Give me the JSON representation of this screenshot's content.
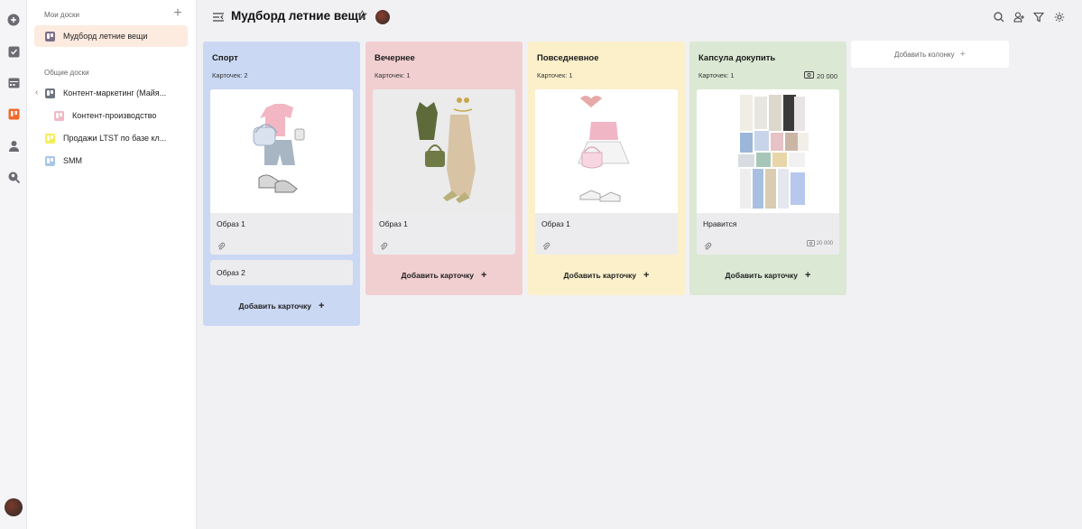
{
  "sidebar": {
    "my_boards_title": "Мои доски",
    "shared_boards_title": "Общие доски",
    "my_boards": [
      {
        "label": "Мудборд летние вещи",
        "color": "#7b6f86"
      }
    ],
    "shared_boards": [
      {
        "label": "Контент-маркетинг (Майя...",
        "color": "#6e7380"
      },
      {
        "label": "Контент-производство",
        "color": "#f2b8c4"
      },
      {
        "label": "Продажи LTST по базе кл...",
        "color": "#f2ee5c"
      },
      {
        "label": "SMM",
        "color": "#a9c6e8"
      }
    ]
  },
  "header": {
    "title": "Мудборд летние вещи"
  },
  "board": {
    "add_card_label": "Добавить карточку",
    "add_column_label": "Добавить колонку",
    "columns": [
      {
        "title": "Спорт",
        "count_label": "Карточек: 2",
        "color": "#cad8f3",
        "cards": [
          {
            "title": "Образ 1"
          },
          {
            "title": "Образ 2"
          }
        ]
      },
      {
        "title": "Вечернее",
        "count_label": "Карточек: 1",
        "color": "#f1cfd1",
        "cards": [
          {
            "title": "Образ 1"
          }
        ]
      },
      {
        "title": "Повседневное",
        "count_label": "Карточек: 1",
        "color": "#fcf0cb",
        "cards": [
          {
            "title": "Образ 1"
          }
        ]
      },
      {
        "title": "Капсула докупить",
        "count_label": "Карточек: 1",
        "budget": "20 000",
        "color": "#dbe8d4",
        "cards": [
          {
            "title": "Нравится",
            "budget": "20 000"
          }
        ]
      }
    ]
  },
  "icons": {
    "rail": [
      "add-icon",
      "tasks-icon",
      "calendar-icon",
      "boards-icon",
      "profile-icon",
      "search-people-icon"
    ],
    "header_tools": [
      "search-icon",
      "members-icon",
      "filter-icon",
      "settings-icon"
    ]
  },
  "colors": {
    "accent": "#f26a2c",
    "active_item_bg": "#fdebe0"
  }
}
